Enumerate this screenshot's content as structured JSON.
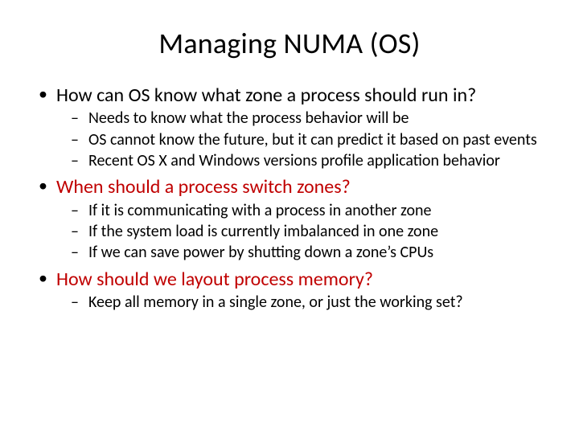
{
  "title": "Managing NUMA (OS)",
  "blocks": [
    {
      "question": "How can OS know what zone a process should run in?",
      "red": false,
      "subs": [
        "Needs to know what the process behavior will be",
        "OS cannot know the future, but it can predict it based on past events",
        "Recent OS X and Windows versions profile application behavior"
      ]
    },
    {
      "question": "When should a process switch zones?",
      "red": true,
      "subs": [
        "If it is communicating with a process in another zone",
        "If the system load is currently imbalanced in one zone",
        "If we can save power by shutting down a zone’s CPUs"
      ]
    },
    {
      "question": "How should we layout process memory?",
      "red": true,
      "subs": [
        "Keep all memory in a single zone, or just the working set?"
      ]
    }
  ]
}
